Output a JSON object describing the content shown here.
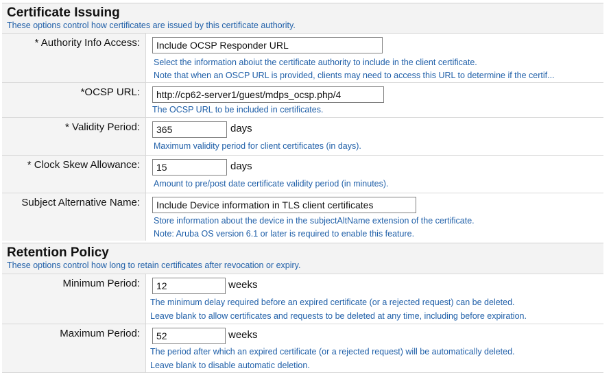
{
  "certificate_issuing": {
    "title": "Certificate Issuing",
    "description": "These options control how certificates are issued by this certificate authority.",
    "authority_info_access": {
      "label": "* Authority Info Access:",
      "value": "Include OCSP Responder URL",
      "hint1": "Select the information aboiut the certificate authority to include in the client certificate.",
      "hint2": "Note that when an OSCP URL is provided, clients may need to access this URL to determine if the certif..."
    },
    "ocsp_url": {
      "label": "*OCSP URL:",
      "value": "http://cp62-server1/guest/mdps_ocsp.php/4",
      "hint1": "The OCSP URL to be included in certificates."
    },
    "validity_period": {
      "label": "* Validity Period:",
      "value": "365",
      "unit": "days",
      "hint1": "Maximum validity period for client certificates (in days)."
    },
    "clock_skew": {
      "label": "* Clock Skew Allowance:",
      "value": "15",
      "unit": "days",
      "hint1": "Amount to pre/post date certificate validity period (in minutes)."
    },
    "subject_alt_name": {
      "label": "Subject Alternative Name:",
      "value": "Include Device information in TLS client certificates",
      "hint1": "Store information about the device in the subjectAltName extension of the certificate.",
      "hint2": "Note: Aruba OS version 6.1 or later is required to enable this feature."
    }
  },
  "retention_policy": {
    "title": "Retention Policy",
    "description": "These options control how long to retain certificates after revocation or expiry.",
    "minimum_period": {
      "label": "Minimum Period:",
      "value": "12",
      "unit": "weeks",
      "hint1": "The minimum delay required before an expired certificate (or a rejected request) can be deleted.",
      "hint2": "Leave blank to allow certificates and requests to be deleted at any time, including before expiration."
    },
    "maximum_period": {
      "label": "Maximum Period:",
      "value": "52",
      "unit": "weeks",
      "hint1": "The period after which an expired certificate (or a rejected request) will be automatically deleted.",
      "hint2": "Leave blank to disable automatic deletion."
    }
  }
}
